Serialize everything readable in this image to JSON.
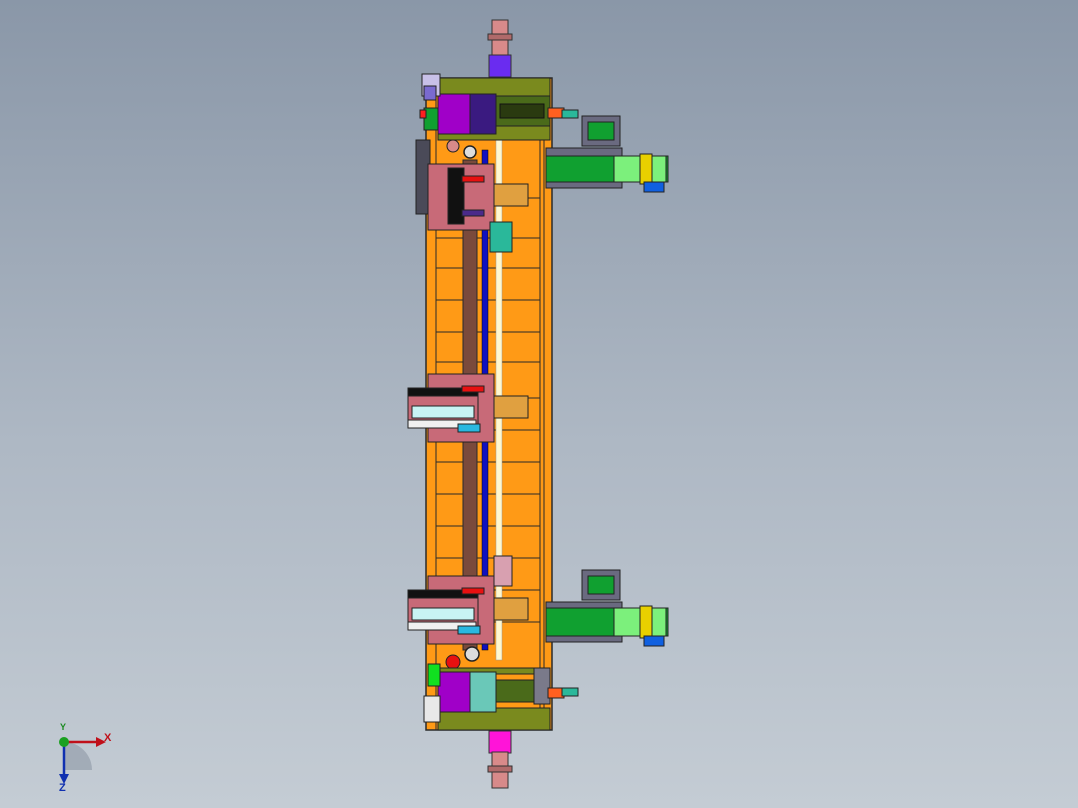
{
  "viewport": {
    "name": "cad-model-view",
    "colors": {
      "background_top": "#8a97a8",
      "background_bottom": "#c4ccd4",
      "frame": "#ff9a16",
      "frame_edge": "#2a2a2a",
      "rail": "#7a4a3c",
      "guide": "#1010c0",
      "slider": "#c86a78",
      "motor_purple": "#a000c8",
      "block_olive": "#7a8a1e",
      "arm_green": "#10a030",
      "arm_light_green": "#7cf07c",
      "bracket_grey": "#6a6a80",
      "shaft_pink": "#d88a8a",
      "top_block": "#6a2cf0",
      "bottom_block": "#ff14d8",
      "teal": "#2ab89a",
      "cyan": "#c8f4f4"
    }
  },
  "triad": {
    "x_label": "X",
    "y_label": "Y",
    "z_label": "Z"
  }
}
